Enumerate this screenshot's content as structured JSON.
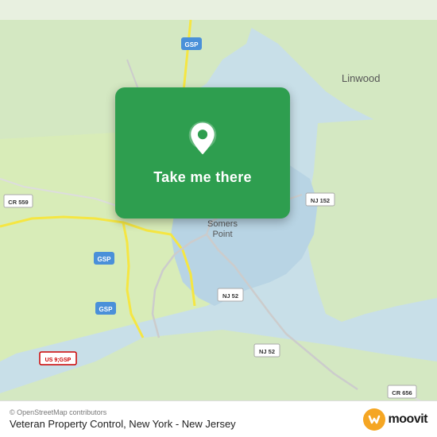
{
  "map": {
    "attribution": "© OpenStreetMap contributors",
    "location_title": "Veteran Property Control, New York - New Jersey",
    "action_label": "Take me there",
    "moovit_label": "moovit",
    "bg_color": "#e8f4e8"
  },
  "labels": {
    "linwood": "Linwood",
    "somers_point": "Somers\nPoint",
    "gsp1": "GSP",
    "gsp2": "GSP",
    "gsp3": "GSP",
    "cr559": "CR 559",
    "nj152": "NJ 152",
    "nj52a": "NJ 52",
    "nj52b": "NJ 52",
    "cr656": "CR 656",
    "us9gsp": "US 9;GSP"
  }
}
